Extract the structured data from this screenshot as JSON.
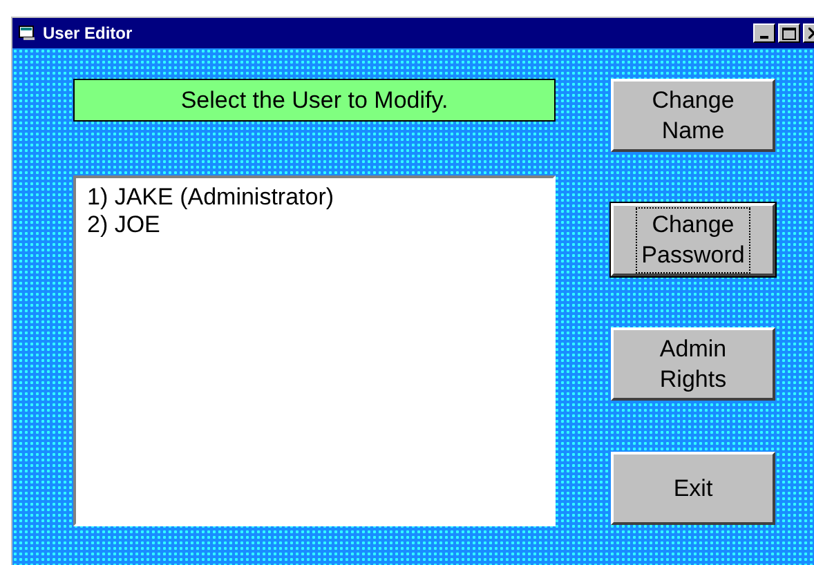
{
  "window": {
    "title": "User Editor"
  },
  "prompt": "Select the User to Modify.",
  "users": [
    {
      "label": "1) JAKE (Administrator)",
      "selected": false
    },
    {
      "label": "2) JOE",
      "selected": false
    }
  ],
  "buttons": [
    {
      "label": "Change\nName",
      "focused": false
    },
    {
      "label": "Change\nPassword",
      "focused": true
    },
    {
      "label": "Admin\nRights",
      "focused": false
    },
    {
      "label": "Exit",
      "focused": false
    }
  ]
}
